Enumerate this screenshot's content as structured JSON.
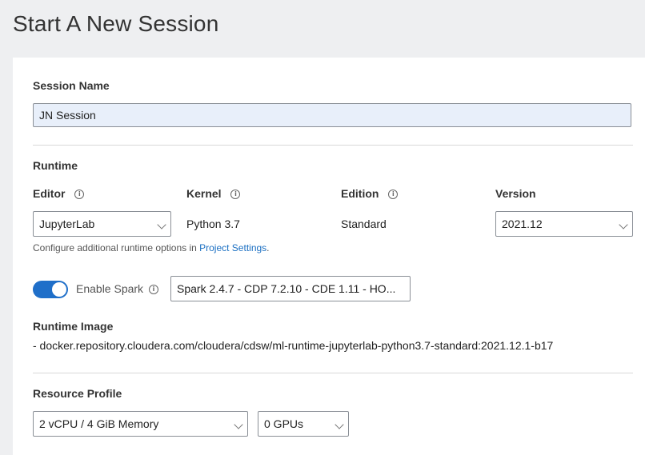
{
  "page": {
    "title": "Start A New Session"
  },
  "session_name": {
    "label": "Session Name",
    "value": "JN Session"
  },
  "runtime": {
    "section_label": "Runtime",
    "editor": {
      "label": "Editor",
      "value": "JupyterLab"
    },
    "kernel": {
      "label": "Kernel",
      "value": "Python 3.7"
    },
    "edition": {
      "label": "Edition",
      "value": "Standard"
    },
    "version": {
      "label": "Version",
      "value": "2021.12"
    },
    "hint_prefix": "Configure additional runtime options in ",
    "hint_link": "Project Settings",
    "hint_suffix": "."
  },
  "spark": {
    "toggle_on": true,
    "label": "Enable Spark",
    "value": "Spark 2.4.7 - CDP 7.2.10 - CDE 1.11 - HO..."
  },
  "runtime_image": {
    "label": "Runtime Image",
    "value": "- docker.repository.cloudera.com/cloudera/cdsw/ml-runtime-jupyterlab-python3.7-standard:2021.12.1-b17"
  },
  "resource_profile": {
    "label": "Resource Profile",
    "cpu_memory": "2 vCPU / 4 GiB Memory",
    "gpus": "0 GPUs"
  },
  "icons": {
    "info": "info-circle-icon",
    "dropdown": "chevron-down-icon"
  },
  "colors": {
    "accent": "#1f6fc9",
    "input_bg": "#e8effa",
    "page_bg": "#eeeff1"
  }
}
